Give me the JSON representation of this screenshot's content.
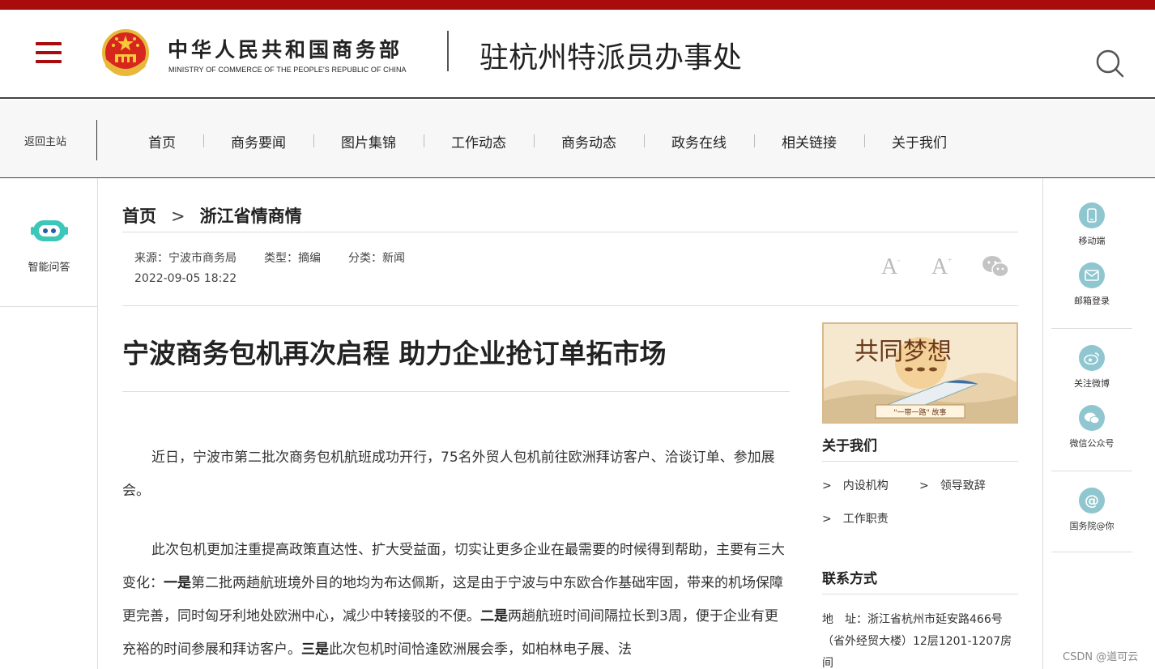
{
  "colors": {
    "brand_red": "#a80c0c",
    "accent_teal": "#8fc6cf",
    "robot_teal": "#3cc7b9"
  },
  "header": {
    "ministry_cn": "中华人民共和国商务部",
    "ministry_en": "MINISTRY OF COMMERCE OF THE PEOPLE'S REPUBLIC OF CHINA",
    "office_title": "驻杭州特派员办事处"
  },
  "nav": {
    "home_link": "返回主站",
    "items": [
      "首页",
      "商务要闻",
      "图片集锦",
      "工作动态",
      "商务动态",
      "政务在线",
      "相关链接",
      "关于我们"
    ]
  },
  "left_sidebar": {
    "assistant_label": "智能问答"
  },
  "right_sidebar": {
    "items": [
      {
        "label": "移动端",
        "icon": "mobile-icon"
      },
      {
        "label": "邮箱登录",
        "icon": "mail-icon"
      },
      {
        "label": "关注微博",
        "icon": "weibo-icon"
      },
      {
        "label": "微信公众号",
        "icon": "wechat-icon"
      },
      {
        "label": "国务院@你",
        "icon": "at-icon"
      }
    ]
  },
  "breadcrumb": {
    "home": "首页",
    "section": "浙江省情商情"
  },
  "meta": {
    "source": "来源：宁波市商务局",
    "type": "类型：摘编",
    "category": "分类：新闻",
    "date": "2022-09-05 18:22",
    "font_small": "A",
    "font_small_mark": "-",
    "font_large": "A",
    "font_large_mark": "+"
  },
  "article": {
    "title": "宁波商务包机再次启程 助力企业抢订单拓市场",
    "para1": "近日，宁波市第二批次商务包机航班成功开行，75名外贸人包机前往欧洲拜访客户、洽谈订单、参加展会。",
    "para2": {
      "intro": "此次包机更加注重提高政策直达性、扩大受益面，切实让更多企业在最需要的时候得到帮助，主要有三大变化：",
      "b1": "一是",
      "t1": "第二批两趟航班境外目的地均为布达佩斯，这是由于宁波与中东欧合作基础牢固，带来的机场保障更完善，同时匈牙利地处欧洲中心，减少中转接驳的不便。",
      "b2": "二是",
      "t2": "两趟航班时间间隔拉长到3周，便于企业有更充裕的时间参展和拜访客户。",
      "b3": "三是",
      "t3": "此次包机时间恰逢欧洲展会季，如柏林电子展、法"
    }
  },
  "banner": {
    "title": "共同梦想",
    "tag": "\"一带一路\"  故事"
  },
  "about": {
    "heading": "关于我们",
    "links": [
      "内设机构",
      "领导致辞",
      "工作职责"
    ]
  },
  "contact": {
    "heading": "联系方式",
    "address_label": "地　址：",
    "address": "浙江省杭州市延安路466号（省外经贸大楼）12层1201-1207房间"
  },
  "watermark": "CSDN @道可云"
}
